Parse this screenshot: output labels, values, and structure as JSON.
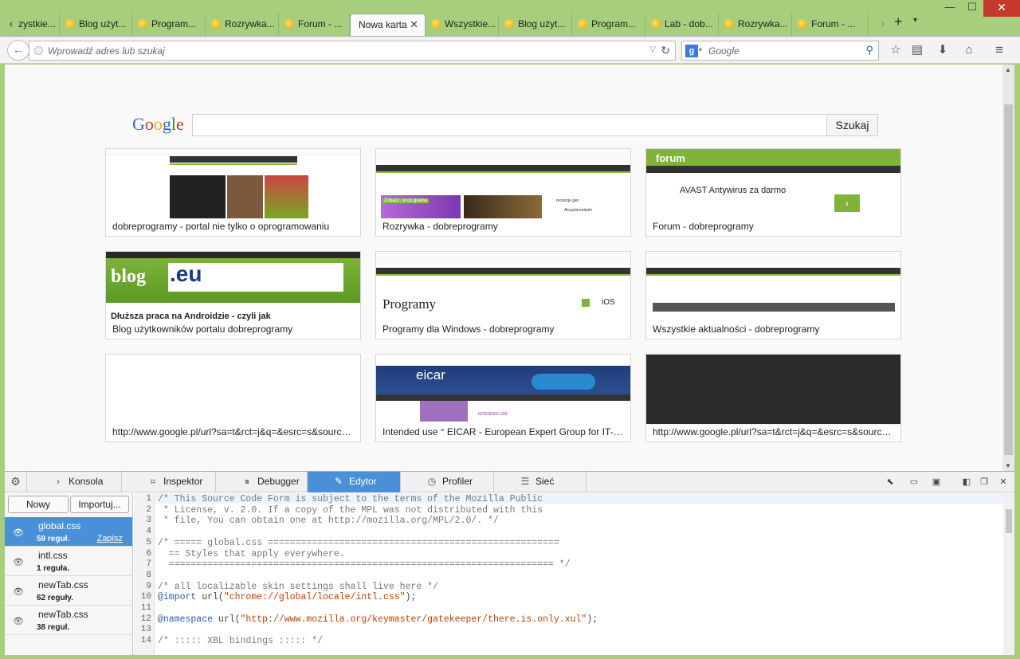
{
  "window": {
    "minimize": "—",
    "maximize": "☐",
    "close": "✕"
  },
  "tabs": [
    {
      "label": "zystkie..."
    },
    {
      "label": "Blog użyt..."
    },
    {
      "label": "Program..."
    },
    {
      "label": "Rozrywka..."
    },
    {
      "label": "Forum - ..."
    },
    {
      "label": "Nowa karta",
      "active": true
    },
    {
      "label": "Wszystkie..."
    },
    {
      "label": "Blog użyt..."
    },
    {
      "label": "Program..."
    },
    {
      "label": "Lab - dob..."
    },
    {
      "label": "Rozrywka..."
    },
    {
      "label": "Forum - ..."
    }
  ],
  "nav": {
    "url_placeholder": "Wprowadź adres lub szukaj",
    "search_engine_letter": "g",
    "search_placeholder": "Google"
  },
  "newtab": {
    "google_logo": [
      "G",
      "o",
      "o",
      "g",
      "l",
      "e"
    ],
    "search_button": "Szukaj",
    "tiles": [
      {
        "title": "dobreprogramy - portal nie tylko o oprogramowaniu"
      },
      {
        "title": "Rozrywka - dobreprogramy"
      },
      {
        "title": "Forum - dobreprogramy"
      },
      {
        "title": "Blog użytkowników portalu dobreprogramy"
      },
      {
        "title": "Programy dla Windows - dobreprogramy"
      },
      {
        "title": "Wszystkie aktualności - dobreprogramy"
      },
      {
        "title": "http://www.google.pl/url?sa=t&rct=j&q=&esrc=s&source=..."
      },
      {
        "title": "Intended use ° EICAR - European Expert Group for IT-Security"
      },
      {
        "title": "http://www.google.pl/url?sa=t&rct=j&q=&esrc=s&source=..."
      }
    ],
    "thumb_text": {
      "forum_ad_title": "AVAST Antywirus za darmo",
      "blog_big": "blog",
      "blog_eu": ".eu",
      "blog_headline": "Dłuższa praca na Androidzie - czyli jak",
      "programy_heading": "Programy",
      "programy_ios": "iOS",
      "eicar_logo": "eicar",
      "eicar_intended": "INTENDED USE",
      "rozrywka_label": "Zobacz, w co grame",
      "rozrywka_item1": "recenzje gier",
      "rozrywka_item2": "Akcja/strzelanki"
    }
  },
  "devtools": {
    "tabs": [
      {
        "label": "Konsola",
        "icon": "›"
      },
      {
        "label": "Inspektor",
        "icon": "⌗"
      },
      {
        "label": "Debugger",
        "icon": "⏸"
      },
      {
        "label": "Edytor stylów",
        "icon": "✎",
        "active": true
      },
      {
        "label": "Profiler",
        "icon": "◷"
      },
      {
        "label": "Sieć",
        "icon": "☰"
      }
    ],
    "new_button": "Nowy",
    "import_button": "Importuj...",
    "save_link": "Zapisz",
    "stylesheets": [
      {
        "name": "global.css",
        "rules": "59 reguł.",
        "active": true
      },
      {
        "name": "intl.css",
        "rules": "1 reguła."
      },
      {
        "name": "newTab.css",
        "rules": "62 reguły."
      },
      {
        "name": "newTab.css",
        "rules": "38 reguł."
      }
    ],
    "code_lines": [
      {
        "n": "1",
        "t": "/* This Source Code Form is subject to the terms of the Mozilla Public",
        "k": "cmt"
      },
      {
        "n": "2",
        "t": " * License, v. 2.0. If a copy of the MPL was not distributed with this",
        "k": "cmt"
      },
      {
        "n": "3",
        "t": " * file, You can obtain one at http://mozilla.org/MPL/2.0/. */",
        "k": "cmt"
      },
      {
        "n": "4",
        "t": "",
        "k": "cmt"
      },
      {
        "n": "5",
        "t": "/* ===== global.css =====================================================",
        "k": "cmt"
      },
      {
        "n": "6",
        "t": "  == Styles that apply everywhere.",
        "k": "cmt"
      },
      {
        "n": "7",
        "t": "  ====================================================================== */",
        "k": "cmt"
      },
      {
        "n": "8",
        "t": "",
        "k": "cmt"
      },
      {
        "n": "9",
        "t": "/* all localizable skin settings shall live here */",
        "k": "cmt"
      },
      {
        "n": "10",
        "t": "@import url(\"chrome://global/locale/intl.css\");",
        "k": "import"
      },
      {
        "n": "11",
        "t": "",
        "k": "cmt"
      },
      {
        "n": "12",
        "t": "@namespace url(\"http://www.mozilla.org/keymaster/gatekeeper/there.is.only.xul\");",
        "k": "ns"
      },
      {
        "n": "13",
        "t": "",
        "k": "cmt"
      },
      {
        "n": "14",
        "t": "/* ::::: XBL bindings ::::: */",
        "k": "cmt"
      }
    ]
  }
}
